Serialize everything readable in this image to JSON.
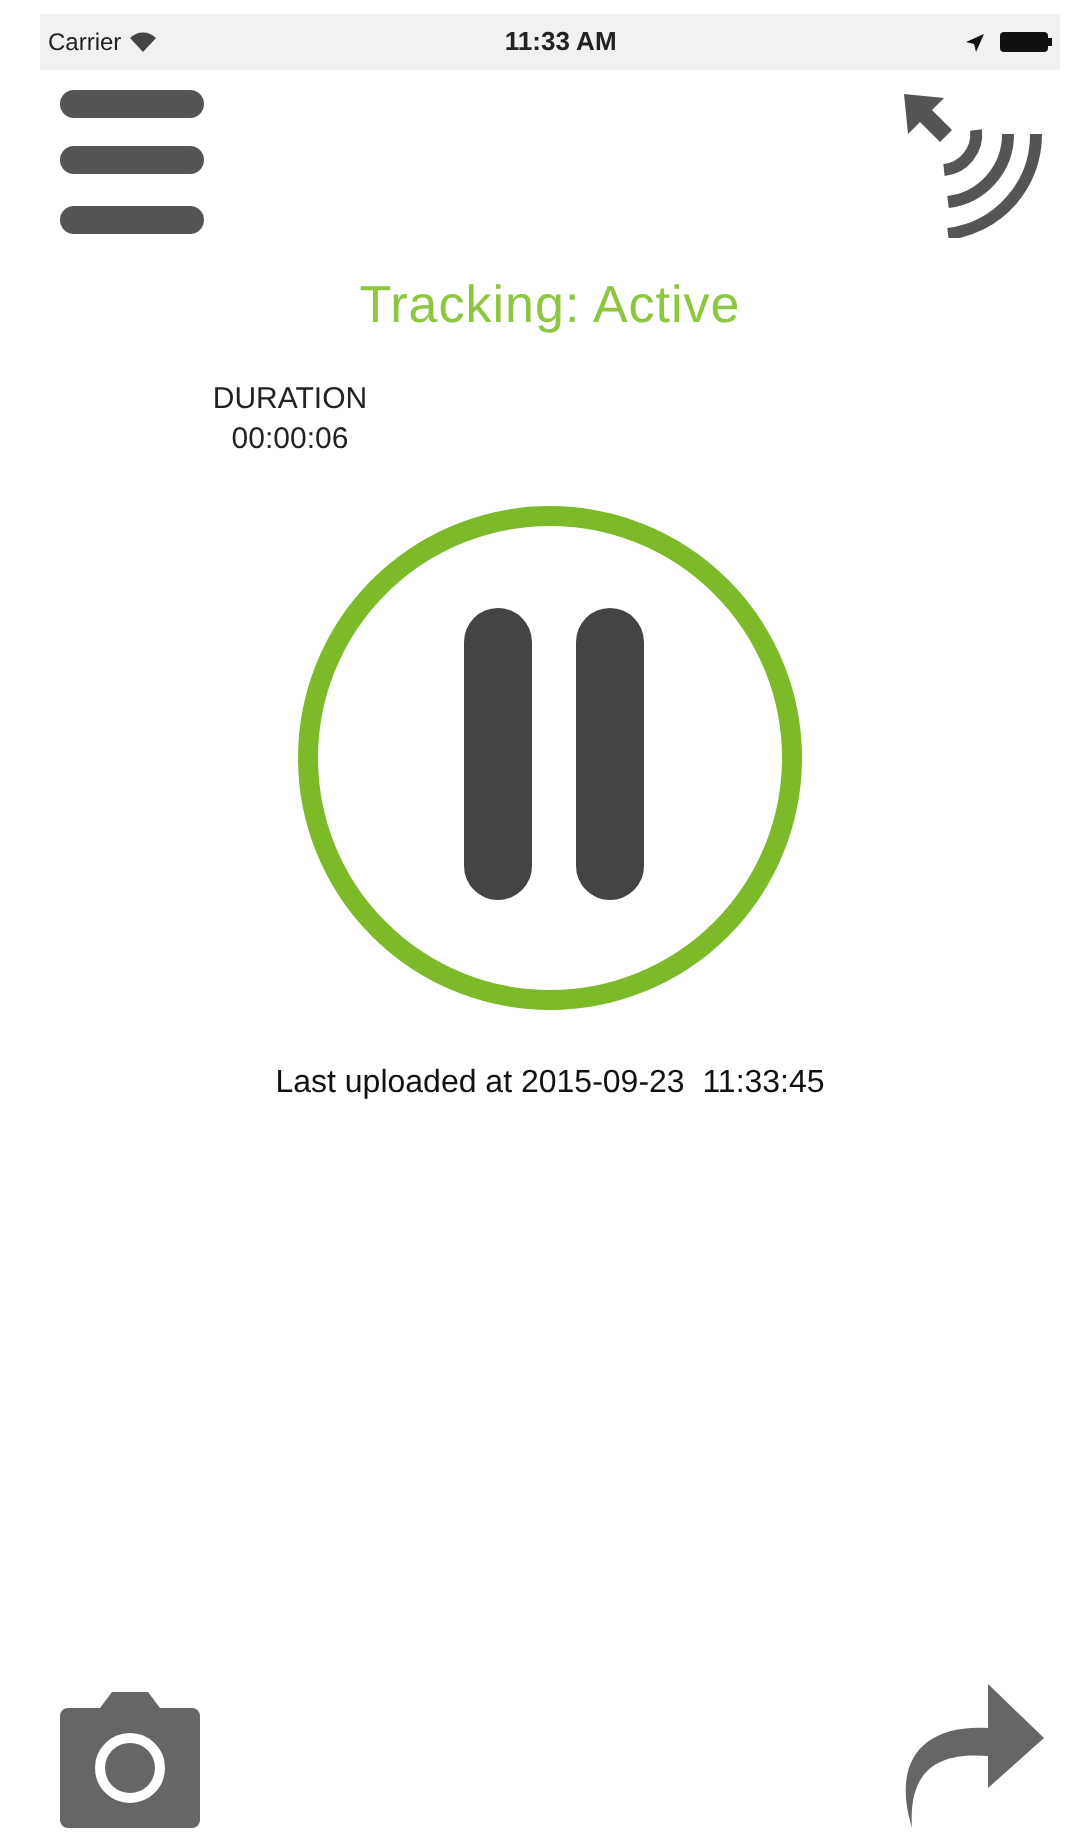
{
  "status_bar": {
    "carrier": "Carrier",
    "time": "11:33 AM"
  },
  "title": "Tracking: Active",
  "duration": {
    "label": "DURATION",
    "value": "00:00:06"
  },
  "tracking_active": true,
  "last_uploaded": "Last uploaded at 2015-09-23  11:33:45"
}
